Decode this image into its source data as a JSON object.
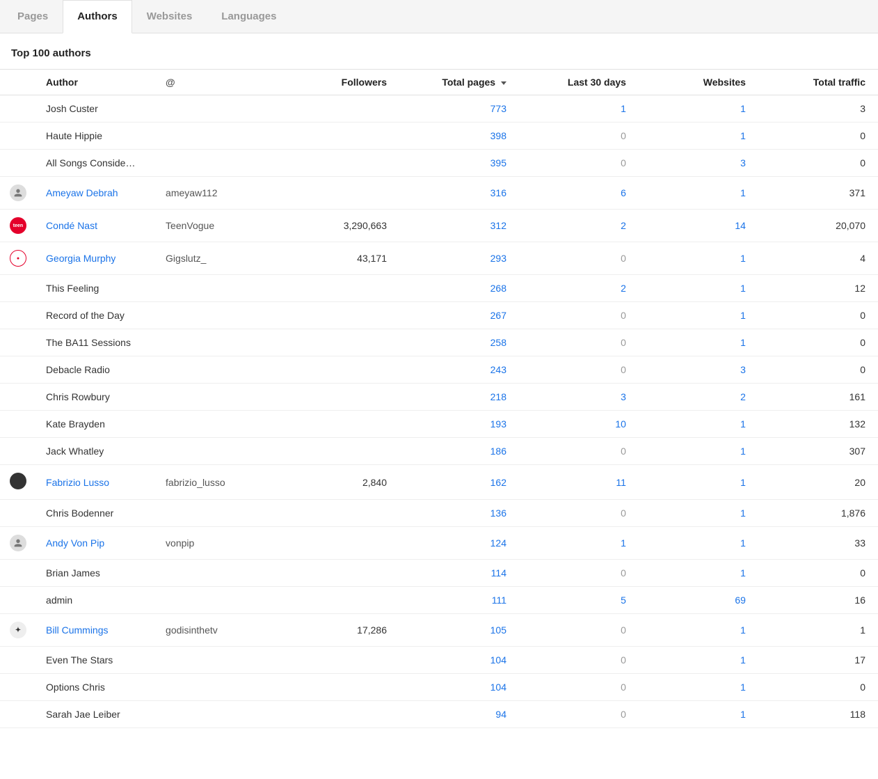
{
  "tabs": [
    "Pages",
    "Authors",
    "Websites",
    "Languages"
  ],
  "active_tab": "Authors",
  "heading": "Top 100 authors",
  "columns": {
    "author": "Author",
    "handle": "@",
    "followers": "Followers",
    "total_pages": "Total pages",
    "last30": "Last 30 days",
    "websites": "Websites",
    "traffic": "Total traffic"
  },
  "sort_column": "total_pages",
  "rows": [
    {
      "avatar": null,
      "author": "Josh Custer",
      "link": false,
      "handle": "",
      "followers": "",
      "pages": "773",
      "last30": "1",
      "last30_muted": false,
      "websites": "1",
      "traffic": "3"
    },
    {
      "avatar": null,
      "author": "Haute Hippie",
      "link": false,
      "handle": "",
      "followers": "",
      "pages": "398",
      "last30": "0",
      "last30_muted": true,
      "websites": "1",
      "traffic": "0"
    },
    {
      "avatar": null,
      "author": "All Songs Conside…",
      "link": false,
      "handle": "",
      "followers": "",
      "pages": "395",
      "last30": "0",
      "last30_muted": true,
      "websites": "3",
      "traffic": "0"
    },
    {
      "avatar": "person",
      "author": "Ameyaw Debrah",
      "link": true,
      "handle": "ameyaw112",
      "followers": "",
      "pages": "316",
      "last30": "6",
      "last30_muted": false,
      "websites": "1",
      "traffic": "371"
    },
    {
      "avatar": "teen",
      "author": "Condé Nast",
      "link": true,
      "handle": "TeenVogue",
      "followers": "3,290,663",
      "pages": "312",
      "last30": "2",
      "last30_muted": false,
      "websites": "14",
      "traffic": "20,070"
    },
    {
      "avatar": "gig",
      "author": "Georgia Murphy",
      "link": true,
      "handle": "Gigslutz_",
      "followers": "43,171",
      "pages": "293",
      "last30": "0",
      "last30_muted": true,
      "websites": "1",
      "traffic": "4"
    },
    {
      "avatar": null,
      "author": "This Feeling",
      "link": false,
      "handle": "",
      "followers": "",
      "pages": "268",
      "last30": "2",
      "last30_muted": false,
      "websites": "1",
      "traffic": "12"
    },
    {
      "avatar": null,
      "author": "Record of the Day",
      "link": false,
      "handle": "",
      "followers": "",
      "pages": "267",
      "last30": "0",
      "last30_muted": true,
      "websites": "1",
      "traffic": "0"
    },
    {
      "avatar": null,
      "author": "The BA11 Sessions",
      "link": false,
      "handle": "",
      "followers": "",
      "pages": "258",
      "last30": "0",
      "last30_muted": true,
      "websites": "1",
      "traffic": "0"
    },
    {
      "avatar": null,
      "author": "Debacle Radio",
      "link": false,
      "handle": "",
      "followers": "",
      "pages": "243",
      "last30": "0",
      "last30_muted": true,
      "websites": "3",
      "traffic": "0"
    },
    {
      "avatar": null,
      "author": "Chris Rowbury",
      "link": false,
      "handle": "",
      "followers": "",
      "pages": "218",
      "last30": "3",
      "last30_muted": false,
      "websites": "2",
      "traffic": "161"
    },
    {
      "avatar": null,
      "author": "Kate Brayden",
      "link": false,
      "handle": "",
      "followers": "",
      "pages": "193",
      "last30": "10",
      "last30_muted": false,
      "websites": "1",
      "traffic": "132"
    },
    {
      "avatar": null,
      "author": "Jack Whatley",
      "link": false,
      "handle": "",
      "followers": "",
      "pages": "186",
      "last30": "0",
      "last30_muted": true,
      "websites": "1",
      "traffic": "307"
    },
    {
      "avatar": "dark",
      "author": "Fabrizio Lusso",
      "link": true,
      "handle": "fabrizio_lusso",
      "followers": "2,840",
      "pages": "162",
      "last30": "11",
      "last30_muted": false,
      "websites": "1",
      "traffic": "20"
    },
    {
      "avatar": null,
      "author": "Chris Bodenner",
      "link": false,
      "handle": "",
      "followers": "",
      "pages": "136",
      "last30": "0",
      "last30_muted": true,
      "websites": "1",
      "traffic": "1,876"
    },
    {
      "avatar": "person",
      "author": "Andy Von Pip",
      "link": true,
      "handle": "vonpip",
      "followers": "",
      "pages": "124",
      "last30": "1",
      "last30_muted": false,
      "websites": "1",
      "traffic": "33"
    },
    {
      "avatar": null,
      "author": "Brian James",
      "link": false,
      "handle": "",
      "followers": "",
      "pages": "114",
      "last30": "0",
      "last30_muted": true,
      "websites": "1",
      "traffic": "0"
    },
    {
      "avatar": null,
      "author": "admin",
      "link": false,
      "handle": "",
      "followers": "",
      "pages": "111",
      "last30": "5",
      "last30_muted": false,
      "websites": "69",
      "traffic": "16"
    },
    {
      "avatar": "light",
      "author": "Bill Cummings",
      "link": true,
      "handle": "godisinthetv",
      "followers": "17,286",
      "pages": "105",
      "last30": "0",
      "last30_muted": true,
      "websites": "1",
      "traffic": "1"
    },
    {
      "avatar": null,
      "author": "Even The Stars",
      "link": false,
      "handle": "",
      "followers": "",
      "pages": "104",
      "last30": "0",
      "last30_muted": true,
      "websites": "1",
      "traffic": "17"
    },
    {
      "avatar": null,
      "author": "Options Chris",
      "link": false,
      "handle": "",
      "followers": "",
      "pages": "104",
      "last30": "0",
      "last30_muted": true,
      "websites": "1",
      "traffic": "0"
    },
    {
      "avatar": null,
      "author": "Sarah Jae Leiber",
      "link": false,
      "handle": "",
      "followers": "",
      "pages": "94",
      "last30": "0",
      "last30_muted": true,
      "websites": "1",
      "traffic": "118"
    }
  ]
}
